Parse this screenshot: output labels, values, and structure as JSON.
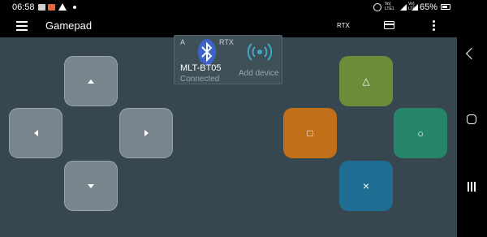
{
  "status_bar": {
    "time": "06:58",
    "battery": "65%",
    "signal_label_1": "Vo) LTE1",
    "signal_label_2": "Vo) LTE2"
  },
  "toolbar": {
    "title": "Gamepad",
    "rtx_label": "RTX"
  },
  "connection": {
    "mode_left": "A",
    "mode_right": "RTX",
    "device_name": "MLT-BT05",
    "device_status": "Connected",
    "add_device_label": "Add device"
  },
  "face_buttons": {
    "triangle": "△",
    "square": "□",
    "circle": "○",
    "cross": "×"
  },
  "colors": {
    "background": "#37474f",
    "dpad": "#78858c",
    "triangle": "#6b8d3a",
    "square": "#c07019",
    "circle": "#27866a",
    "cross": "#1e6e93",
    "bluetooth": "#3d62c9",
    "wifi_accent": "#3aa9c7"
  }
}
